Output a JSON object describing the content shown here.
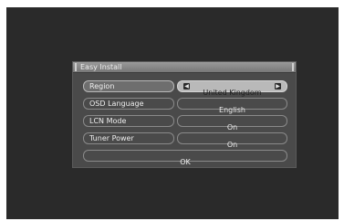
{
  "dialog": {
    "title": "Easy Install",
    "rows": [
      {
        "label": "Region",
        "value": "United Kingdom"
      },
      {
        "label": "OSD Language",
        "value": "English"
      },
      {
        "label": "LCN Mode",
        "value": "On"
      },
      {
        "label": "Tuner Power",
        "value": "On"
      }
    ],
    "ok_label": "OK",
    "left_arrow_glyph": "◀",
    "right_arrow_glyph": "▶"
  },
  "colors": {
    "background": "#2a2a2a",
    "dialog": "#4a4a4a",
    "selected_value": "#b9b9b9"
  }
}
